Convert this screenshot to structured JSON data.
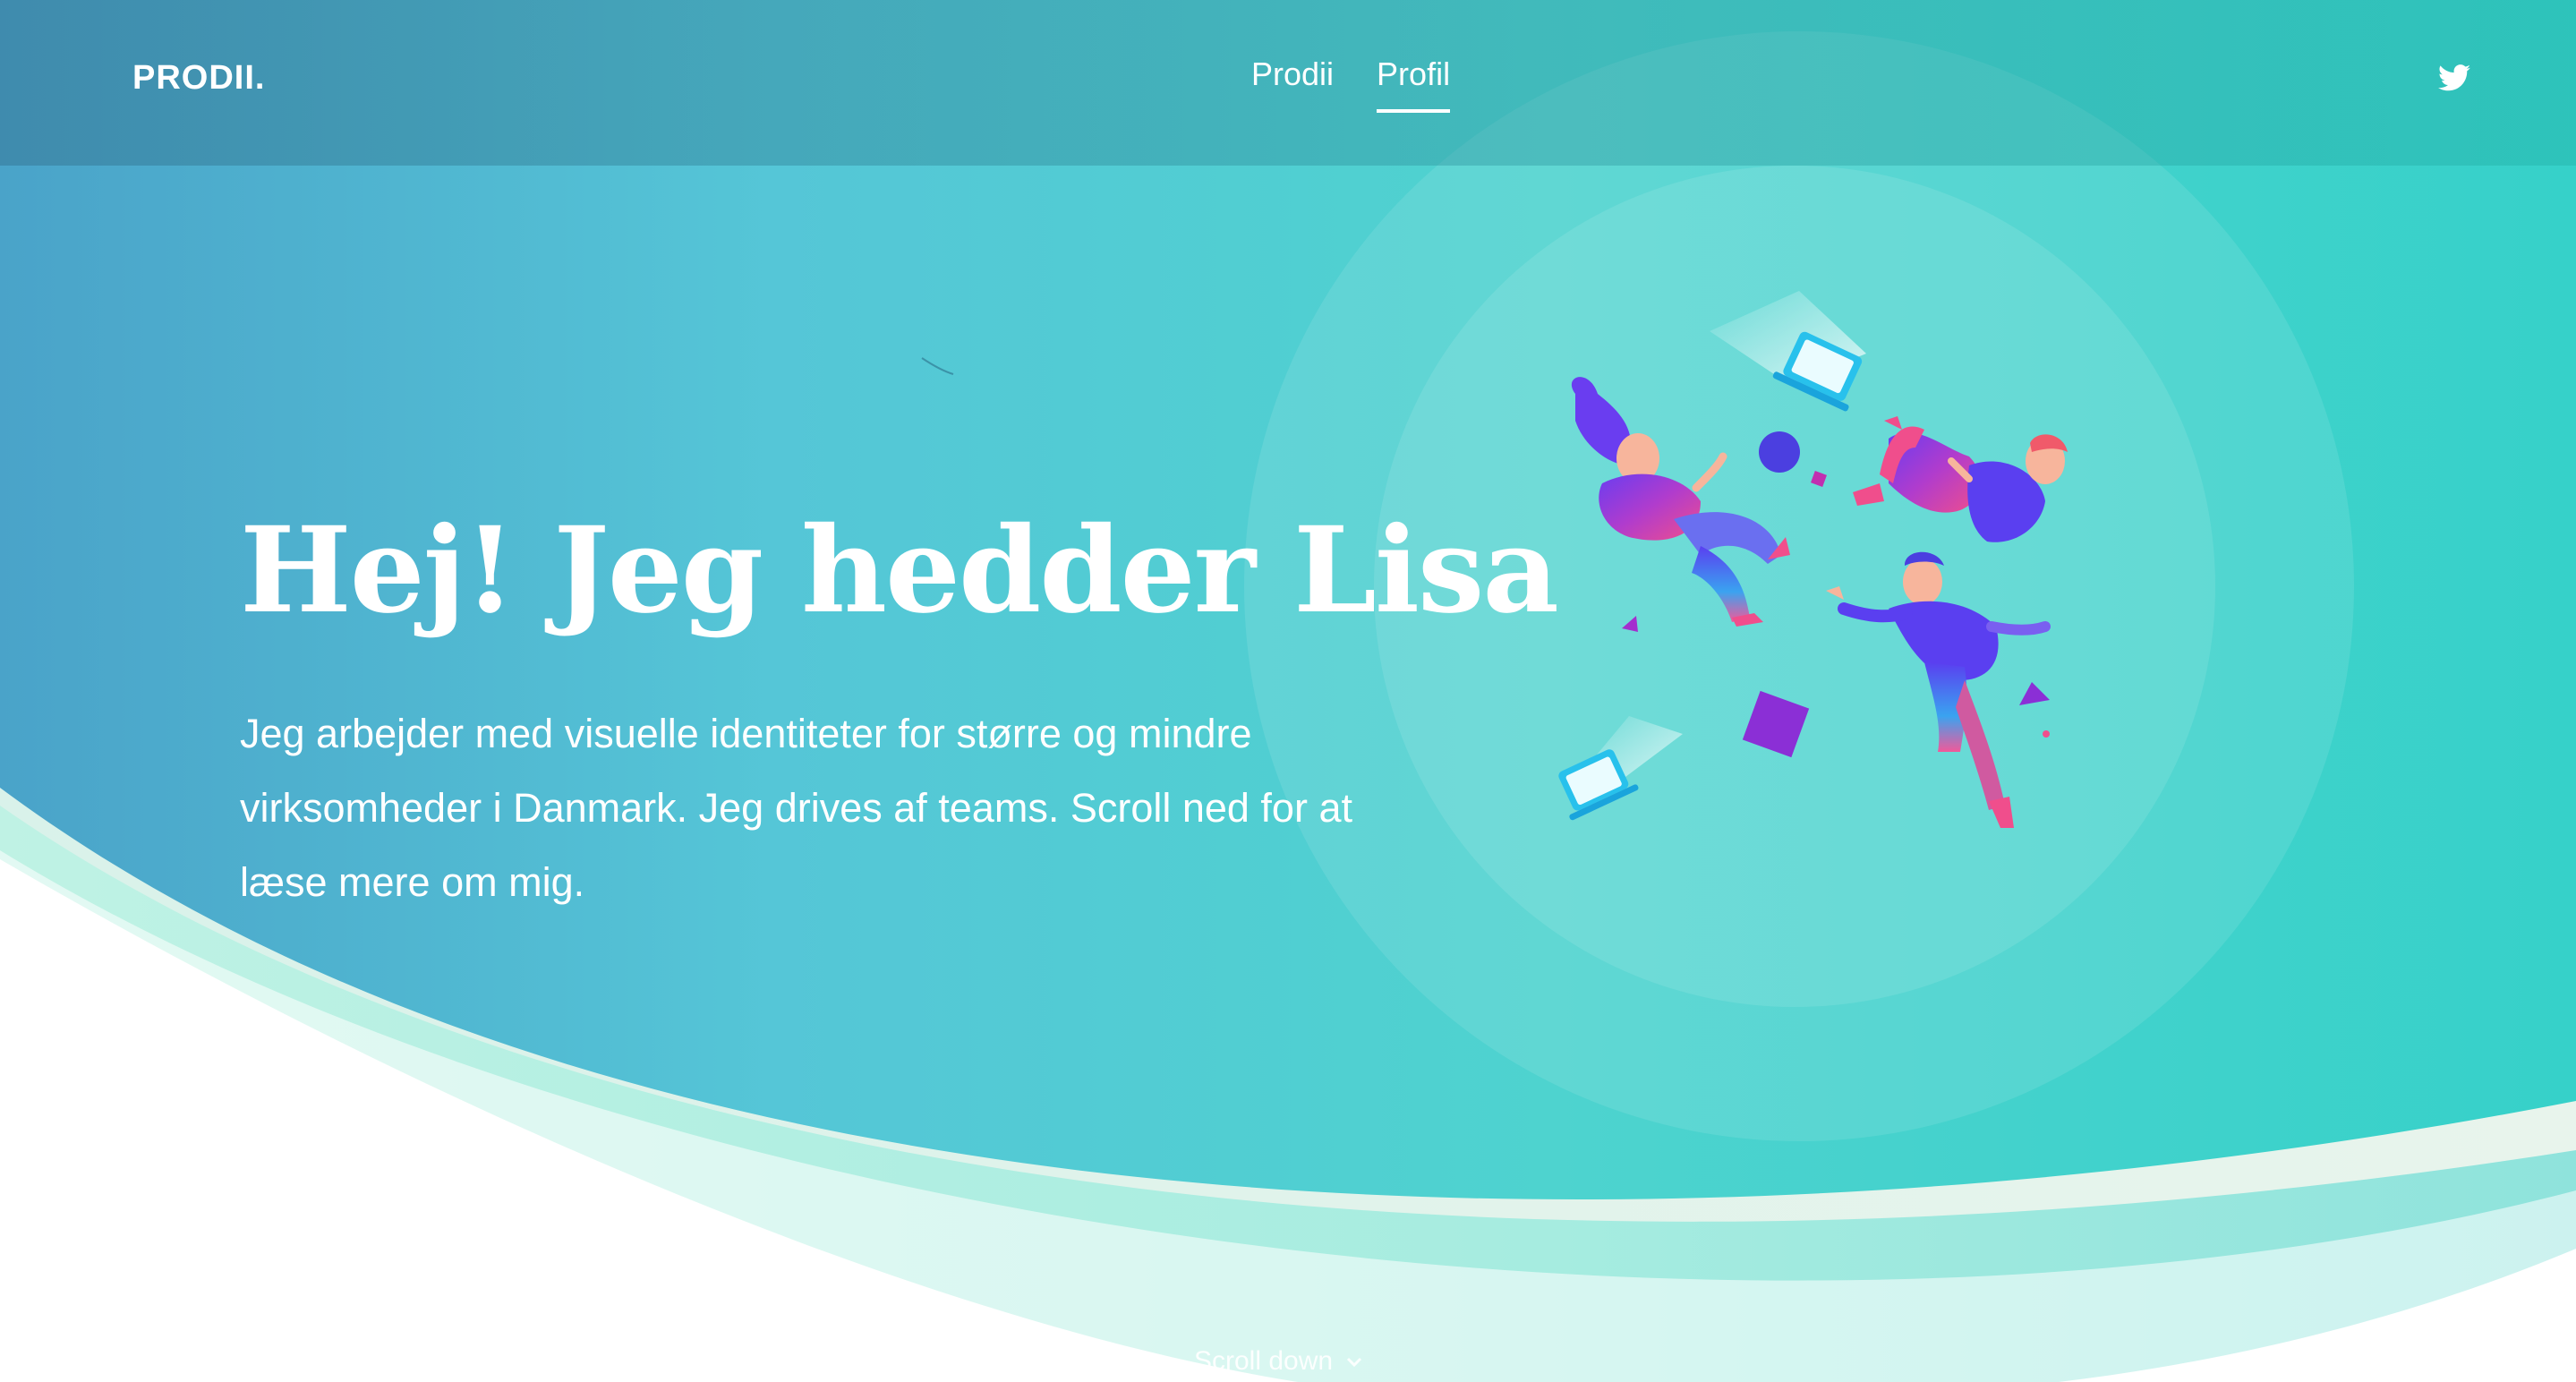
{
  "nav": {
    "logo": "PRODII.",
    "links": [
      {
        "label": "Prodii",
        "active": false
      },
      {
        "label": "Profil",
        "active": true
      }
    ],
    "social_icon": "twitter-icon"
  },
  "hero": {
    "headline": "Hej! Jeg hedder Lisa",
    "intro": "Jeg arbejder med visuelle identiteter for større og mindre virksomheder i Danmark. Jeg drives af teams. Scroll ned for at læse mere om mig."
  },
  "scroll": {
    "label": "Scroll down",
    "icon": "chevron-down-icon"
  },
  "colors": {
    "gradient_start": "#4aa3c9",
    "gradient_end": "#36d1c9",
    "text": "#ffffff"
  }
}
